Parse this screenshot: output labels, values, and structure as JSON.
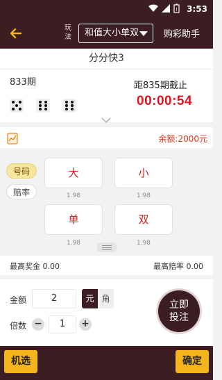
{
  "status_bar": {
    "time": "3:53"
  },
  "header": {
    "play_label": "玩法",
    "play_type": "和值大小单双",
    "helper": "购彩助手"
  },
  "game": {
    "title": "分分快3"
  },
  "draw": {
    "period": "833期",
    "dice": [
      5,
      6,
      6
    ],
    "deadline": "距835期截止",
    "countdown": "00:00:54"
  },
  "balance": "余额:2000元",
  "tabs": [
    {
      "label": "号码",
      "active": true
    },
    {
      "label": "赔率",
      "active": false
    }
  ],
  "options": [
    {
      "label": "大",
      "rate": "1.98"
    },
    {
      "label": "小",
      "rate": "1.98"
    },
    {
      "label": "单",
      "rate": "1.98"
    },
    {
      "label": "双",
      "rate": "1.98"
    }
  ],
  "limits": {
    "max_prize_label": "最高奖金",
    "max_prize": "0.00",
    "max_odds_label": "最高赔率",
    "max_odds": "0.00"
  },
  "form": {
    "amount_label": "金额",
    "amount": "2",
    "unit_yuan": "元",
    "unit_jiao": "角",
    "multiple_label": "倍数",
    "multiple": "1",
    "minus": "−",
    "plus": "+",
    "place_bet_line1": "立即",
    "place_bet_line2": "投注"
  },
  "footer": {
    "random": "机选",
    "confirm": "确定"
  },
  "colors": {
    "brand": "#3b1d22",
    "accent": "#f3b41c",
    "countdown": "#e0141e"
  },
  "icons": [
    "wifi-icon",
    "signal-icon",
    "battery-icon",
    "back-arrow-icon",
    "chevron-down-icon",
    "trend-chart-icon"
  ]
}
